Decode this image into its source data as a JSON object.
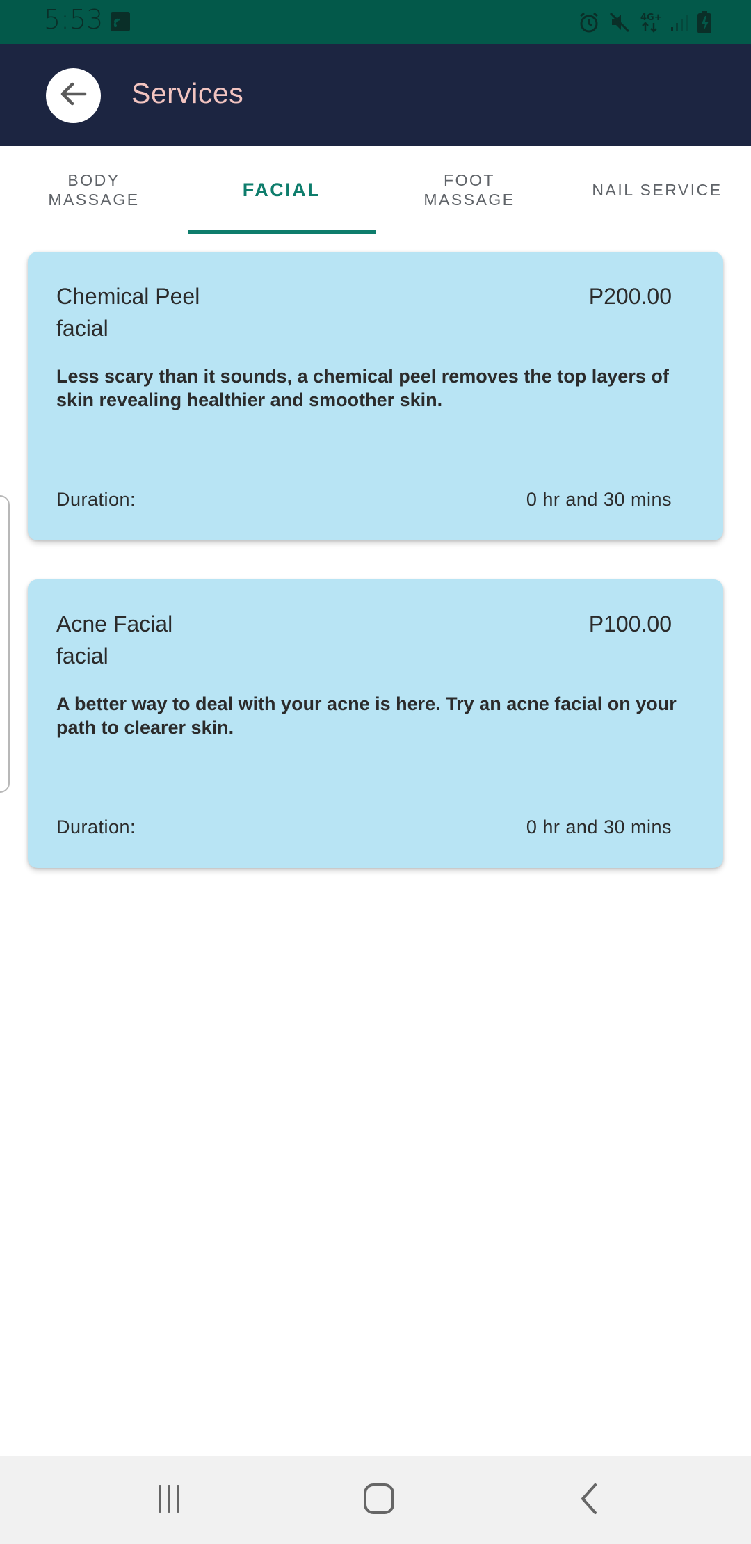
{
  "status_bar": {
    "time": "5:53",
    "icons": [
      "screen-mirror-icon",
      "alarm-icon",
      "mute-icon",
      "4g-data-icon",
      "signal-icon",
      "battery-charging-icon"
    ]
  },
  "app_bar": {
    "title": "Services",
    "back_icon": "arrow-back-icon"
  },
  "tabs": [
    {
      "label": "BODY\nMASSAGE",
      "active": false
    },
    {
      "label": "FACIAL",
      "active": true
    },
    {
      "label": "FOOT\nMASSAGE",
      "active": false
    },
    {
      "label": "NAIL SERVICE",
      "active": false
    }
  ],
  "services": [
    {
      "name": "Chemical Peel",
      "category": "facial",
      "price": "P200.00",
      "description": "Less scary than it sounds, a chemical peel removes the top layers of skin revealing healthier and smoother skin.",
      "duration_label": "Duration:",
      "duration_value": "0 hr and 30 mins"
    },
    {
      "name": "Acne Facial",
      "category": "facial",
      "price": "P100.00",
      "description": "A better way to deal with your acne is here. Try an acne facial on your path to clearer skin.",
      "duration_label": "Duration:",
      "duration_value": "0 hr and 30 mins"
    }
  ],
  "nav_bar": {
    "icons": [
      "recent-apps-icon",
      "home-icon",
      "back-icon"
    ]
  },
  "colors": {
    "status_bar": "#03594a",
    "app_bar": "#1c2541",
    "title": "#f2c4c0",
    "accent": "#0e7d6c",
    "card": "#b8e4f4"
  }
}
